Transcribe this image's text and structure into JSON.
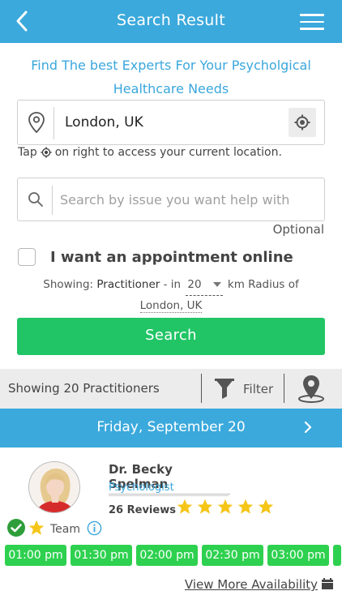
{
  "header": {
    "title": "Search Result"
  },
  "tagline": "Find The best Experts For Your Psycholgical Healthcare Needs",
  "location": {
    "value": "London, UK"
  },
  "hint": {
    "before": "Tap",
    "after": "on right to access your current location."
  },
  "issue_search": {
    "placeholder": "Search by issue you want help with",
    "optional_label": "Optional"
  },
  "appointment": {
    "label": "I want an appointment online"
  },
  "showing": {
    "prefix": "Showing:",
    "type": "Practitioner",
    "mid": "- in",
    "radius": "20",
    "suffix": "km Radius of",
    "location": "London, UK"
  },
  "search_button": "Search",
  "filter_bar": {
    "count_text": "Showing 20 Practitioners",
    "filter_label": "Filter"
  },
  "date_bar": {
    "date": "Friday, September 20"
  },
  "practitioner": {
    "name": "Dr. Becky Spelman",
    "role": "Psychologist",
    "reviews": "26 Reviews",
    "rating": 5,
    "team_label": "Team",
    "slots": [
      "01:00 pm",
      "01:30 pm",
      "02:00 pm",
      "02:30 pm",
      "03:00 pm"
    ],
    "view_more": "View More Availability"
  },
  "colors": {
    "primary_blue": "#3ba9dc",
    "search_green": "#22c566",
    "slot_green": "#2ed14f",
    "star_yellow": "#f5c518"
  }
}
